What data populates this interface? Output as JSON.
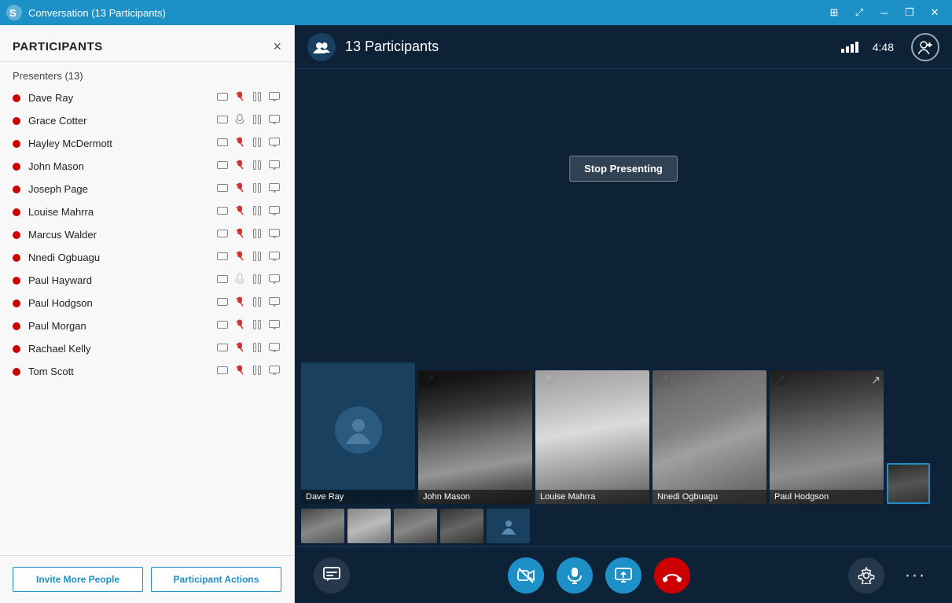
{
  "titlebar": {
    "title": "Conversation (13 Participants)",
    "logo_text": "S",
    "controls": [
      "tile-icon",
      "maximize",
      "minimize",
      "restore",
      "close"
    ]
  },
  "sidebar": {
    "title": "PARTICIPANTS",
    "close_label": "×",
    "presenters_label": "Presenters (13)",
    "participants": [
      {
        "name": "Dave Ray",
        "status": "red",
        "icons": [
          "chat",
          "mic-off",
          "pause",
          "screen"
        ]
      },
      {
        "name": "Grace Cotter",
        "status": "red",
        "icons": [
          "chat",
          "mic-on",
          "camera",
          "screen"
        ]
      },
      {
        "name": "Hayley McDermott",
        "status": "red",
        "icons": [
          "chat",
          "mic-off",
          "pause",
          "screen"
        ]
      },
      {
        "name": "John Mason",
        "status": "red",
        "icons": [
          "chat",
          "mic-off",
          "pause",
          "screen"
        ]
      },
      {
        "name": "Joseph Page",
        "status": "red",
        "icons": [
          "chat",
          "mic-off",
          "pause",
          "screen"
        ]
      },
      {
        "name": "Louise Mahrra",
        "status": "red",
        "icons": [
          "chat",
          "mic-off",
          "pause",
          "screen"
        ]
      },
      {
        "name": "Marcus Walder",
        "status": "red",
        "icons": [
          "chat",
          "mic-off",
          "pause",
          "screen"
        ]
      },
      {
        "name": "Nnedi Ogbuagu",
        "status": "red",
        "icons": [
          "chat",
          "mic-off",
          "pause",
          "screen"
        ]
      },
      {
        "name": "Paul Hayward",
        "status": "red",
        "icons": [
          "chat",
          "mic-gray",
          "pause",
          "screen"
        ]
      },
      {
        "name": "Paul Hodgson",
        "status": "red",
        "icons": [
          "chat",
          "mic-off",
          "pause",
          "screen"
        ]
      },
      {
        "name": "Paul Morgan",
        "status": "red",
        "icons": [
          "chat",
          "mic-off",
          "pause",
          "screen"
        ]
      },
      {
        "name": "Rachael Kelly",
        "status": "red",
        "icons": [
          "chat",
          "mic-off",
          "pause",
          "screen"
        ]
      },
      {
        "name": "Tom Scott",
        "status": "red",
        "icons": [
          "chat",
          "mic-raise",
          "pause",
          "screen"
        ]
      }
    ],
    "invite_btn": "Invite More People",
    "actions_btn": "Participant Actions"
  },
  "video_area": {
    "participants_count": "13 Participants",
    "timer": "4:48",
    "stop_presenting_btn": "Stop Presenting",
    "video_tiles": [
      {
        "name": "Dave Ray",
        "type": "placeholder",
        "muted": false
      },
      {
        "name": "John Mason",
        "type": "photo",
        "muted": true
      },
      {
        "name": "Louise Mahrra",
        "type": "photo",
        "muted": true
      },
      {
        "name": "Nnedi Ogbuagu",
        "type": "photo",
        "muted": true
      },
      {
        "name": "Paul Hodgson",
        "type": "photo",
        "muted": true
      }
    ],
    "toolbar": {
      "chat_label": "💬",
      "video_label": "📹",
      "mic_label": "🎤",
      "screen_label": "🖥",
      "end_label": "📞",
      "settings_label": "⚙",
      "more_label": "···"
    }
  }
}
